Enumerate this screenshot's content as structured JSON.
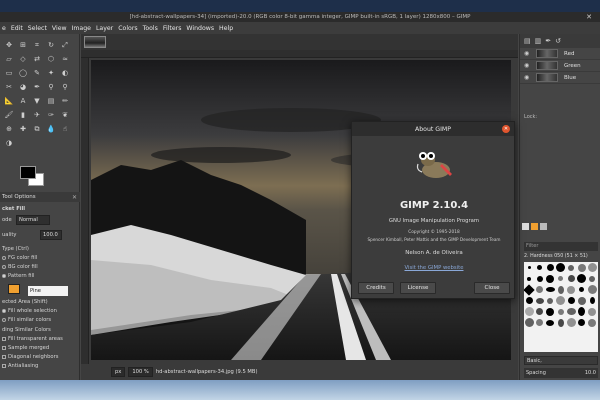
{
  "window": {
    "title": "[hd-abstract-wallpapers-34] (imported)-20.0 (RGB color 8-bit gamma integer, GIMP built-in sRGB, 1 layer) 1280x800 – GIMP"
  },
  "menubar": [
    "e",
    "Edit",
    "Select",
    "View",
    "Image",
    "Layer",
    "Colors",
    "Tools",
    "Filters",
    "Windows",
    "Help"
  ],
  "tool_options": {
    "tab_label": "Tool Options",
    "tool_name": "cket Fill",
    "mode_label": "ode",
    "mode_value": "Normal",
    "opacity_label": "uality",
    "opacity_value": "100.0",
    "fill_type_label": "Type  (Ctrl)",
    "fill_options": [
      "FG color fill",
      "BG color fill",
      "Pattern fill"
    ],
    "pattern_name": "Pine",
    "affected_area_label": "ected Area  (Shift)",
    "affected_options": [
      "Fill whole selection",
      "Fill similar colors"
    ],
    "similar_colors_label": "ding Similar Colors",
    "similar_options": [
      "Fill transparent areas",
      "Sample merged",
      "Diagonal neighbors",
      "Antialiasing"
    ]
  },
  "channels": [
    {
      "name": "Red"
    },
    {
      "name": "Green"
    },
    {
      "name": "Blue"
    }
  ],
  "lock_label": "Lock:",
  "brushes": {
    "filter_placeholder": "Filter",
    "brush_name": "2. Hardness 050 (51 × 51)",
    "preset": "Basic,",
    "spacing_label": "Spacing",
    "spacing_value": "10.0"
  },
  "statusbar": {
    "unit": "px",
    "zoom": "100 %",
    "file_info": "hd-abstract-wallpapers-34.jpg (9.5 MB)"
  },
  "about": {
    "title": "About GIMP",
    "version": "GIMP 2.10.4",
    "subtitle": "GNU Image Manipulation Program",
    "copyright": "Copyright © 1995-2018",
    "authors_line": "Spencer Kimball, Peter Mattis and the GIMP Development Team",
    "author": "Nelson A. de Oliveira",
    "link": "Visit the GIMP website",
    "buttons": {
      "credits": "Credits",
      "license": "License",
      "close": "Close"
    }
  },
  "colors": {
    "accent_close": "#e0552e",
    "link": "#8aa8d8",
    "pattern_swatch": "#f0a030"
  }
}
